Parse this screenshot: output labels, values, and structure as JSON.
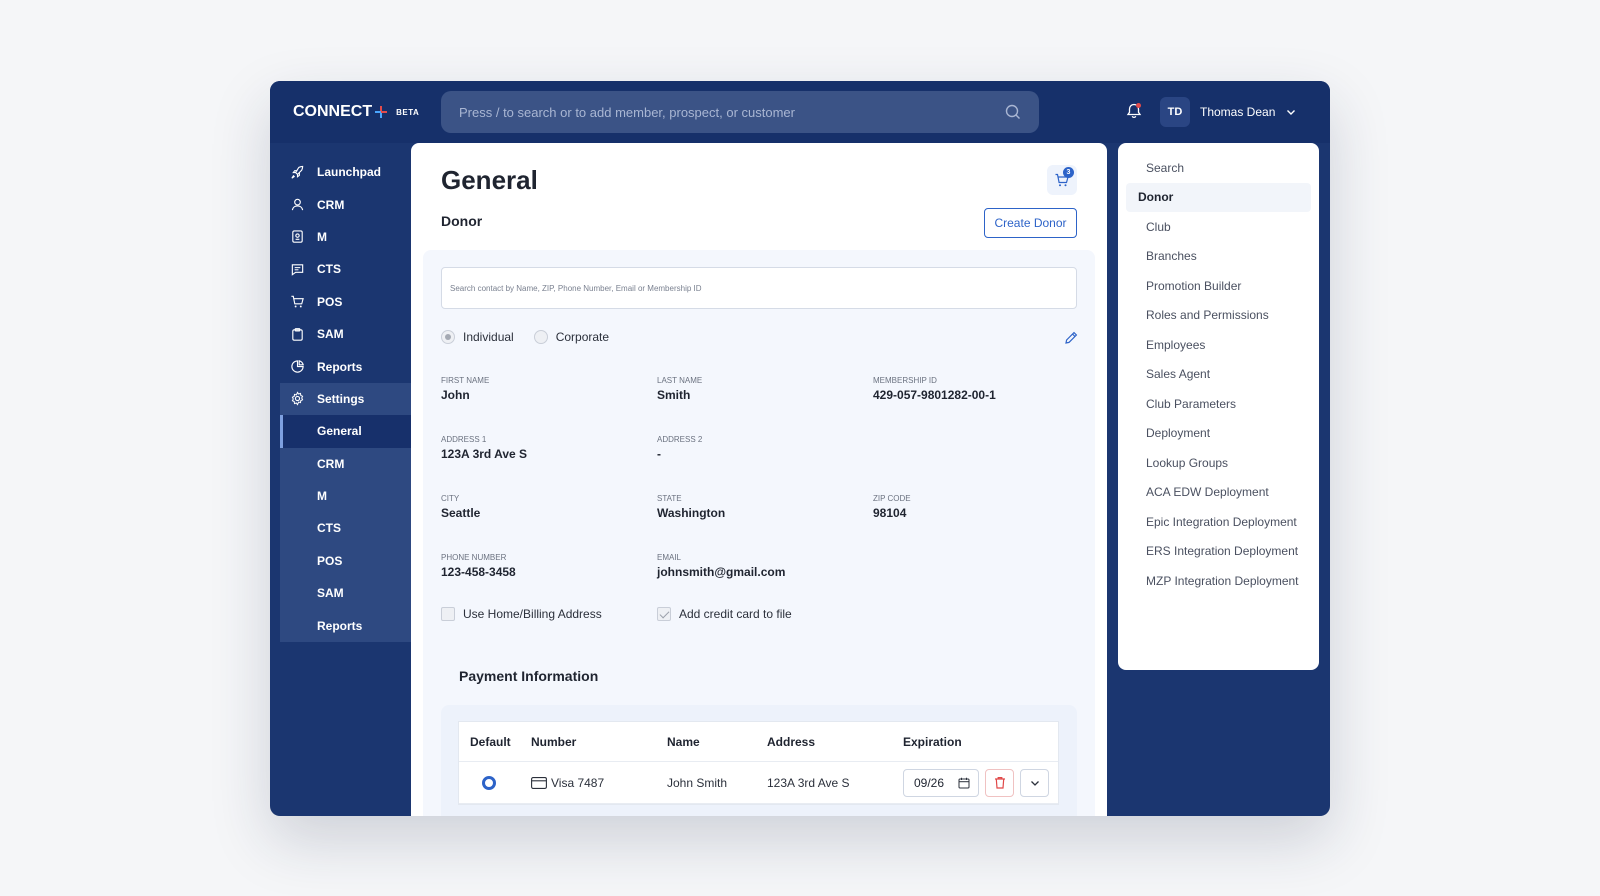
{
  "brand": {
    "name": "CONNECT",
    "badge": "BETA"
  },
  "search": {
    "placeholder": "Press / to search or to add member, prospect, or customer"
  },
  "user": {
    "initials": "TD",
    "name": "Thomas Dean"
  },
  "sidebar": {
    "items": [
      {
        "label": "Launchpad",
        "icon": "rocket-icon"
      },
      {
        "label": "CRM",
        "icon": "user-icon"
      },
      {
        "label": "M",
        "icon": "badge-icon"
      },
      {
        "label": "CTS",
        "icon": "chat-icon"
      },
      {
        "label": "POS",
        "icon": "cart-icon"
      },
      {
        "label": "SAM",
        "icon": "clipboard-icon"
      },
      {
        "label": "Reports",
        "icon": "pie-chart-icon"
      },
      {
        "label": "Settings",
        "icon": "gear-icon"
      }
    ],
    "settings_sub": [
      "General",
      "CRM",
      "M",
      "CTS",
      "POS",
      "SAM",
      "Reports"
    ]
  },
  "main": {
    "title": "General",
    "cart_count": "3",
    "section": "Donor",
    "create_button": "Create Donor",
    "contact_search_placeholder": "Search contact by Name, ZIP, Phone Number, Email or Membership ID",
    "type_options": [
      "Individual",
      "Corporate"
    ],
    "fields": {
      "first_name": {
        "label": "FIRST NAME",
        "value": "John"
      },
      "last_name": {
        "label": "LAST NAME",
        "value": "Smith"
      },
      "membership_id": {
        "label": "MEMBERSHIP ID",
        "value": "429-057-9801282-00-1"
      },
      "address1": {
        "label": "ADDRESS 1",
        "value": "123A 3rd Ave S"
      },
      "address2": {
        "label": "ADDRESS 2",
        "value": "-"
      },
      "city": {
        "label": "CITY",
        "value": "Seattle"
      },
      "state": {
        "label": "STATE",
        "value": "Washington"
      },
      "zip": {
        "label": "ZIP CODE",
        "value": "98104"
      },
      "phone": {
        "label": "PHONE NUMBER",
        "value": "123-458-3458"
      },
      "email": {
        "label": "EMAIL",
        "value": "johnsmith@gmail.com"
      }
    },
    "checks": {
      "home_billing": "Use Home/Billing Address",
      "add_card": "Add credit card to file"
    },
    "payment": {
      "title": "Payment Information",
      "columns": [
        "Default",
        "Number",
        "Name",
        "Address",
        "Expiration"
      ],
      "rows": [
        {
          "number": "Visa 7487",
          "name": "John Smith",
          "address": "123A 3rd Ave S",
          "expiration": "09/26"
        }
      ]
    }
  },
  "rightnav": {
    "items": [
      "Search",
      "Donor",
      "Club",
      "Branches",
      "Promotion Builder",
      "Roles and Permissions",
      "Employees",
      "Sales Agent",
      "Club Parameters",
      "Deployment",
      "Lookup Groups",
      "ACA EDW Deployment",
      "Epic Integration Deployment",
      "ERS Integration Deployment",
      "MZP Integration Deployment"
    ]
  }
}
